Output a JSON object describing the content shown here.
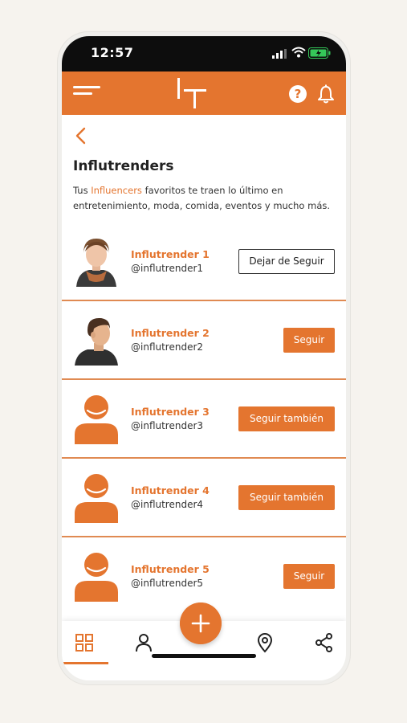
{
  "status": {
    "time": "12:57"
  },
  "header": {
    "menu_icon": "hamburger-icon",
    "logo_text": "IT",
    "help_icon": "question-icon",
    "bell_icon": "bell-icon"
  },
  "page": {
    "back_icon": "chevron-left-icon",
    "title": "Influtrenders",
    "desc_prefix": "Tus ",
    "desc_highlight": "Influencers",
    "desc_suffix": " favoritos te traen lo último en entretenimiento, moda, comida, eventos y mucho más."
  },
  "influencers": [
    {
      "name": "Influtrender 1",
      "handle": "@influtrender1",
      "button": "Dejar de Seguir",
      "button_style": "outline",
      "avatar": "photo-woman"
    },
    {
      "name": "Influtrender 2",
      "handle": "@influtrender2",
      "button": "Seguir",
      "button_style": "filled",
      "avatar": "photo-man"
    },
    {
      "name": "Influtrender 3",
      "handle": "@influtrender3",
      "button": "Seguir también",
      "button_style": "filled",
      "avatar": "default-user"
    },
    {
      "name": "Influtrender 4",
      "handle": "@influtrender4",
      "button": "Seguir también",
      "button_style": "filled",
      "avatar": "default-user"
    },
    {
      "name": "Influtrender 5",
      "handle": "@influtrender5",
      "button": "Seguir",
      "button_style": "filled",
      "avatar": "default-user"
    }
  ],
  "bottom_nav": {
    "items": [
      "grid-icon",
      "user-icon",
      "add-icon",
      "location-icon",
      "share-icon"
    ],
    "active": "grid-icon"
  },
  "colors": {
    "accent": "#e4752f",
    "status_bar": "#0d0d0d",
    "battery": "#35c759"
  }
}
